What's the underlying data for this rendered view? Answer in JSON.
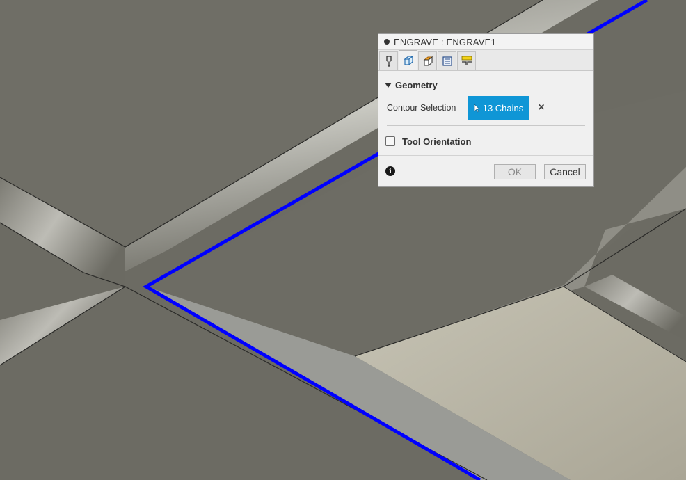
{
  "dialog": {
    "title": "ENGRAVE : ENGRAVE1",
    "tabs": [
      {
        "icon": "tool-icon",
        "active": false
      },
      {
        "icon": "geometry-icon",
        "active": true
      },
      {
        "icon": "heights-icon",
        "active": false
      },
      {
        "icon": "passes-icon",
        "active": false
      },
      {
        "icon": "linking-icon",
        "active": false
      }
    ],
    "geometry_section": "Geometry",
    "contour_label": "Contour Selection",
    "chains_button": "13 Chains",
    "clear_icon": "×",
    "tool_orientation_label": "Tool Orientation",
    "tool_orientation_checked": false,
    "info_icon": "i",
    "ok_label": "OK",
    "cancel_label": "Cancel"
  },
  "colors": {
    "selection_blue": "#0000ff",
    "button_blue": "#0f96d6"
  }
}
